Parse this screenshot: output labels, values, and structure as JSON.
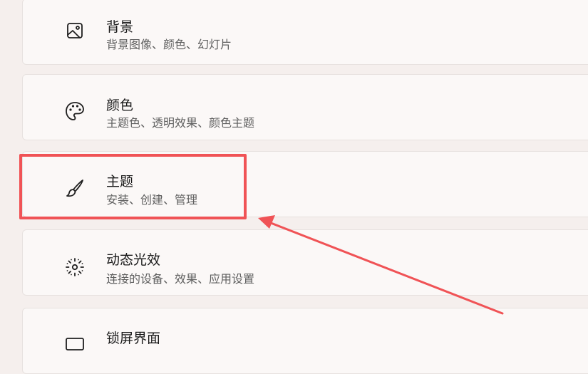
{
  "items": [
    {
      "title": "背景",
      "subtitle": "背景图像、颜色、幻灯片",
      "icon": "image-icon"
    },
    {
      "title": "颜色",
      "subtitle": "主题色、透明效果、颜色主题",
      "icon": "palette-icon"
    },
    {
      "title": "主题",
      "subtitle": "安装、创建、管理",
      "icon": "paintbrush-icon"
    },
    {
      "title": "动态光效",
      "subtitle": "连接的设备、效果、应用设置",
      "icon": "dynamic-lighting-icon"
    },
    {
      "title": "锁屏界面",
      "subtitle": "",
      "icon": "lock-screen-icon"
    }
  ],
  "annotation": {
    "highlight_color": "#f05356",
    "highlighted_item": "主题"
  }
}
